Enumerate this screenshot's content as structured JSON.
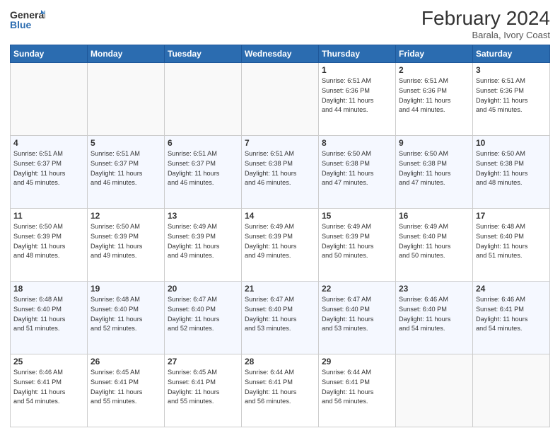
{
  "header": {
    "logo_general": "General",
    "logo_blue": "Blue",
    "month_title": "February 2024",
    "location": "Barala, Ivory Coast"
  },
  "weekdays": [
    "Sunday",
    "Monday",
    "Tuesday",
    "Wednesday",
    "Thursday",
    "Friday",
    "Saturday"
  ],
  "weeks": [
    [
      {
        "day": "",
        "info": ""
      },
      {
        "day": "",
        "info": ""
      },
      {
        "day": "",
        "info": ""
      },
      {
        "day": "",
        "info": ""
      },
      {
        "day": "1",
        "info": "Sunrise: 6:51 AM\nSunset: 6:36 PM\nDaylight: 11 hours\nand 44 minutes."
      },
      {
        "day": "2",
        "info": "Sunrise: 6:51 AM\nSunset: 6:36 PM\nDaylight: 11 hours\nand 44 minutes."
      },
      {
        "day": "3",
        "info": "Sunrise: 6:51 AM\nSunset: 6:36 PM\nDaylight: 11 hours\nand 45 minutes."
      }
    ],
    [
      {
        "day": "4",
        "info": "Sunrise: 6:51 AM\nSunset: 6:37 PM\nDaylight: 11 hours\nand 45 minutes."
      },
      {
        "day": "5",
        "info": "Sunrise: 6:51 AM\nSunset: 6:37 PM\nDaylight: 11 hours\nand 46 minutes."
      },
      {
        "day": "6",
        "info": "Sunrise: 6:51 AM\nSunset: 6:37 PM\nDaylight: 11 hours\nand 46 minutes."
      },
      {
        "day": "7",
        "info": "Sunrise: 6:51 AM\nSunset: 6:38 PM\nDaylight: 11 hours\nand 46 minutes."
      },
      {
        "day": "8",
        "info": "Sunrise: 6:50 AM\nSunset: 6:38 PM\nDaylight: 11 hours\nand 47 minutes."
      },
      {
        "day": "9",
        "info": "Sunrise: 6:50 AM\nSunset: 6:38 PM\nDaylight: 11 hours\nand 47 minutes."
      },
      {
        "day": "10",
        "info": "Sunrise: 6:50 AM\nSunset: 6:38 PM\nDaylight: 11 hours\nand 48 minutes."
      }
    ],
    [
      {
        "day": "11",
        "info": "Sunrise: 6:50 AM\nSunset: 6:39 PM\nDaylight: 11 hours\nand 48 minutes."
      },
      {
        "day": "12",
        "info": "Sunrise: 6:50 AM\nSunset: 6:39 PM\nDaylight: 11 hours\nand 49 minutes."
      },
      {
        "day": "13",
        "info": "Sunrise: 6:49 AM\nSunset: 6:39 PM\nDaylight: 11 hours\nand 49 minutes."
      },
      {
        "day": "14",
        "info": "Sunrise: 6:49 AM\nSunset: 6:39 PM\nDaylight: 11 hours\nand 49 minutes."
      },
      {
        "day": "15",
        "info": "Sunrise: 6:49 AM\nSunset: 6:39 PM\nDaylight: 11 hours\nand 50 minutes."
      },
      {
        "day": "16",
        "info": "Sunrise: 6:49 AM\nSunset: 6:40 PM\nDaylight: 11 hours\nand 50 minutes."
      },
      {
        "day": "17",
        "info": "Sunrise: 6:48 AM\nSunset: 6:40 PM\nDaylight: 11 hours\nand 51 minutes."
      }
    ],
    [
      {
        "day": "18",
        "info": "Sunrise: 6:48 AM\nSunset: 6:40 PM\nDaylight: 11 hours\nand 51 minutes."
      },
      {
        "day": "19",
        "info": "Sunrise: 6:48 AM\nSunset: 6:40 PM\nDaylight: 11 hours\nand 52 minutes."
      },
      {
        "day": "20",
        "info": "Sunrise: 6:47 AM\nSunset: 6:40 PM\nDaylight: 11 hours\nand 52 minutes."
      },
      {
        "day": "21",
        "info": "Sunrise: 6:47 AM\nSunset: 6:40 PM\nDaylight: 11 hours\nand 53 minutes."
      },
      {
        "day": "22",
        "info": "Sunrise: 6:47 AM\nSunset: 6:40 PM\nDaylight: 11 hours\nand 53 minutes."
      },
      {
        "day": "23",
        "info": "Sunrise: 6:46 AM\nSunset: 6:40 PM\nDaylight: 11 hours\nand 54 minutes."
      },
      {
        "day": "24",
        "info": "Sunrise: 6:46 AM\nSunset: 6:41 PM\nDaylight: 11 hours\nand 54 minutes."
      }
    ],
    [
      {
        "day": "25",
        "info": "Sunrise: 6:46 AM\nSunset: 6:41 PM\nDaylight: 11 hours\nand 54 minutes."
      },
      {
        "day": "26",
        "info": "Sunrise: 6:45 AM\nSunset: 6:41 PM\nDaylight: 11 hours\nand 55 minutes."
      },
      {
        "day": "27",
        "info": "Sunrise: 6:45 AM\nSunset: 6:41 PM\nDaylight: 11 hours\nand 55 minutes."
      },
      {
        "day": "28",
        "info": "Sunrise: 6:44 AM\nSunset: 6:41 PM\nDaylight: 11 hours\nand 56 minutes."
      },
      {
        "day": "29",
        "info": "Sunrise: 6:44 AM\nSunset: 6:41 PM\nDaylight: 11 hours\nand 56 minutes."
      },
      {
        "day": "",
        "info": ""
      },
      {
        "day": "",
        "info": ""
      }
    ]
  ]
}
